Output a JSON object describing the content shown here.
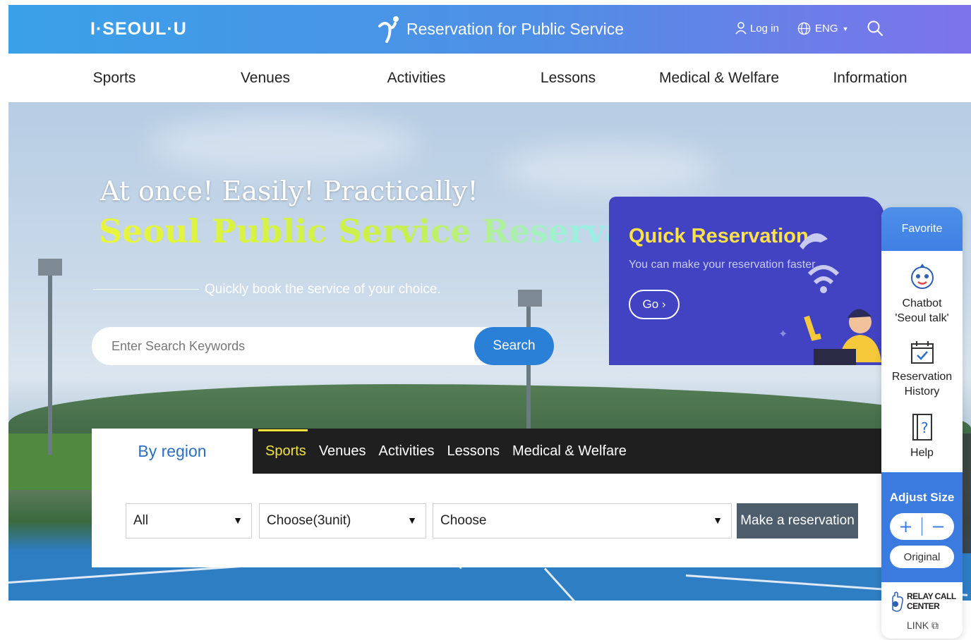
{
  "header": {
    "logo": "I·SEOUL·U",
    "title": "Reservation for Public Service",
    "login_label": "Log in",
    "language_label": "ENG",
    "icons": [
      "user-icon",
      "globe-icon",
      "search-icon"
    ]
  },
  "nav": {
    "items": [
      "Sports",
      "Venues",
      "Activities",
      "Lessons",
      "Medical & Welfare",
      "Information"
    ]
  },
  "hero": {
    "subheading": "At once! Easily! Practically!",
    "title": "Seoul Public Service Reservation",
    "tagline": "Quickly book the service of your choice.",
    "search_placeholder": "Enter Search Keywords",
    "search_button": "Search"
  },
  "quick_reservation": {
    "title": "Quick Reservation",
    "description": "You can make your reservation faster.",
    "go_label": "Go  ›"
  },
  "region_panel": {
    "active_tab": "By region",
    "tabs": [
      "Sports",
      "Venues",
      "Activities",
      "Lessons",
      "Medical & Welfare"
    ],
    "selected_tab": "Sports",
    "selects": {
      "region": "All",
      "unit": "Choose(3unit)",
      "facility": "Choose"
    },
    "reserve_button": "Make a reservation"
  },
  "quick_menu": {
    "title": "Favorite",
    "chatbot_line1": "Chatbot",
    "chatbot_line2": "'Seoul talk'",
    "history_line1": "Reservation",
    "history_line2": "History",
    "help": "Help",
    "adjust_title": "Adjust Size",
    "plus": "+",
    "minus": "−",
    "original": "Original",
    "relay_line1": "RELAY CALL",
    "relay_line2": "CENTER",
    "relay_link": "LINK ⧉"
  },
  "colors": {
    "header_gradient_start": "#3aa1e8",
    "header_gradient_end": "#7d73ea",
    "primary_blue": "#2a7fd6",
    "quick_bg": "#4143c2",
    "quick_title": "#ffe24a",
    "accent_yellow": "#f3e23a",
    "reserve_button": "#4e5d6c"
  }
}
